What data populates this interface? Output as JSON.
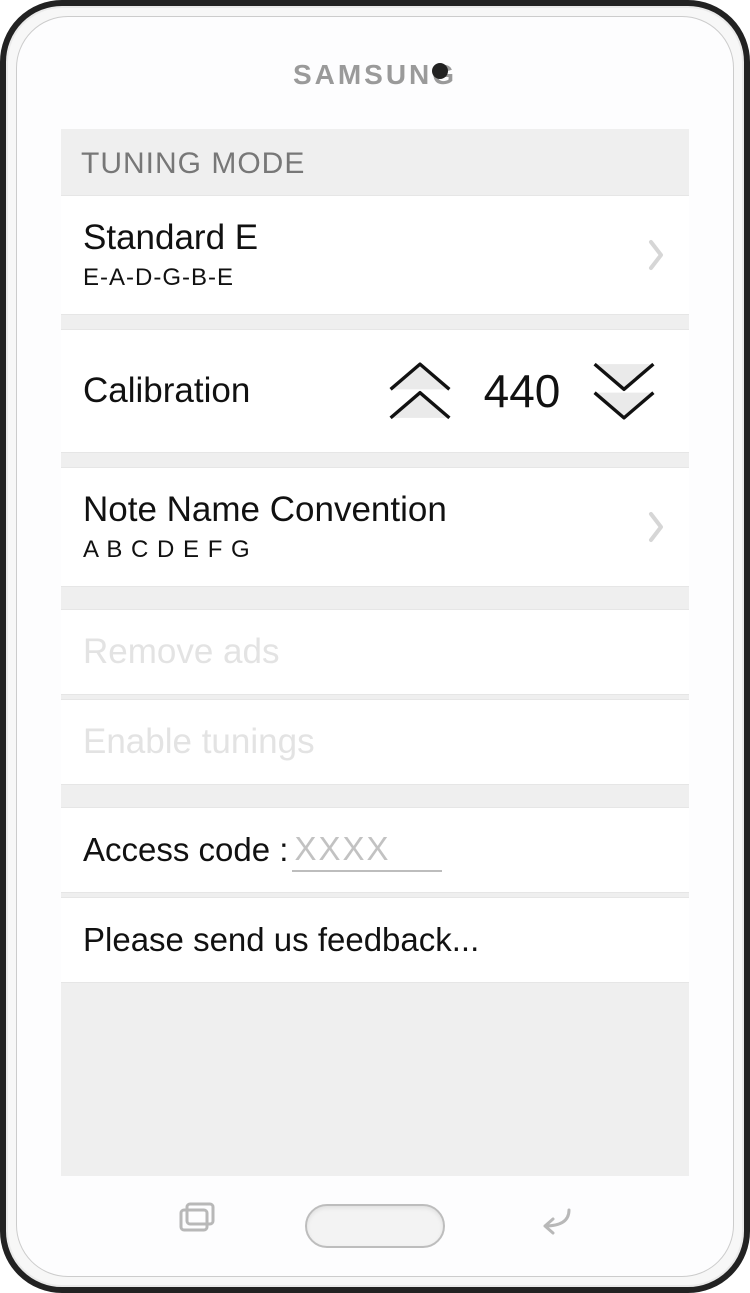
{
  "device": {
    "brand": "SAMSUNG"
  },
  "header": {
    "title": "TUNING MODE"
  },
  "rows": {
    "tuning": {
      "title": "Standard E",
      "subtitle": "E-A-D-G-B-E"
    },
    "calibration": {
      "label": "Calibration",
      "value": "440"
    },
    "convention": {
      "title": "Note Name Convention",
      "subtitle": "A B C D E F G"
    },
    "remove_ads": {
      "label": "Remove ads"
    },
    "enable_tunings": {
      "label": "Enable tunings"
    },
    "access": {
      "label": "Access code : ",
      "placeholder": "XXXX"
    },
    "feedback": {
      "label": "Please send us feedback..."
    }
  }
}
